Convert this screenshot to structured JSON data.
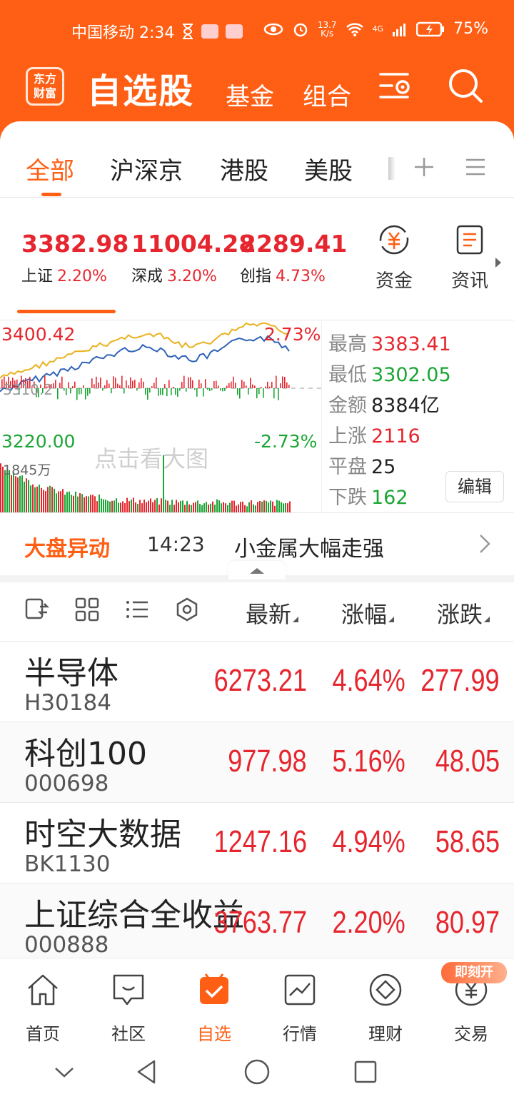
{
  "status_bar": {
    "carrier_time": "中国移动 2:34",
    "net_speed_value": "13.7",
    "net_speed_unit": "K/s",
    "network_type": "4G",
    "battery": "75%"
  },
  "header": {
    "logo_line1": "东方",
    "logo_line2": "财富",
    "title": "自选股",
    "nav": [
      "基金",
      "组合"
    ],
    "icons": [
      "settings-icon",
      "search-icon"
    ]
  },
  "market_tabs": {
    "tabs": [
      "全部",
      "沪深京",
      "港股",
      "美股"
    ],
    "active": "全部",
    "icons": [
      "plus-icon",
      "menu-icon"
    ]
  },
  "indices": [
    {
      "value": "3382.98",
      "name": "上证",
      "pct": "2.20%"
    },
    {
      "value": "11004.28",
      "name": "深成",
      "pct": "3.20%"
    },
    {
      "value": "2289.41",
      "name": "创指",
      "pct": "4.73%"
    }
  ],
  "strip_buttons": [
    {
      "label": "资金",
      "icon": "yuan-flow-icon"
    },
    {
      "label": "资讯",
      "icon": "news-icon"
    }
  ],
  "chart": {
    "high_label": "3400.42",
    "high_pct": "2.73%",
    "low_label": "3220.00",
    "low_pct": "-2.73%",
    "volume_label": "1845万",
    "watermark": "点击看大图",
    "mid_label": "3310.2"
  },
  "stats": [
    {
      "key": "最高",
      "value": "3383.41",
      "color": "#e6262e"
    },
    {
      "key": "最低",
      "value": "3302.05",
      "color": "#1aa534"
    },
    {
      "key": "金额",
      "value": "8384亿",
      "color": "#222222"
    },
    {
      "key": "上涨",
      "value": "2116",
      "color": "#e6262e"
    },
    {
      "key": "平盘",
      "value": "25",
      "color": "#222222"
    },
    {
      "key": "下跌",
      "value": "162",
      "color": "#1aa534"
    }
  ],
  "edit_label": "编辑",
  "movement": {
    "title": "大盘异动",
    "time": "14:23",
    "text": "小金属大幅走强"
  },
  "list_header": {
    "icons": [
      "switch-view-icon",
      "grid-icon",
      "list-icon",
      "gear-circle-icon"
    ],
    "columns": [
      "最新",
      "涨幅",
      "涨跌"
    ]
  },
  "stocks": [
    {
      "name": "半导体",
      "code": "H30184",
      "price": "6273.21",
      "pct": "4.64%",
      "change": "277.99"
    },
    {
      "name": "科创100",
      "code": "000698",
      "price": "977.98",
      "pct": "5.16%",
      "change": "48.05"
    },
    {
      "name": "时空大数据",
      "code": "BK1130",
      "price": "1247.16",
      "pct": "4.94%",
      "change": "58.65"
    },
    {
      "name": "上证综合全收益",
      "code": "000888",
      "price": "3763.77",
      "pct": "2.20%",
      "change": "80.97"
    }
  ],
  "bottom_nav": [
    {
      "label": "首页",
      "icon": "home-icon"
    },
    {
      "label": "社区",
      "icon": "community-icon"
    },
    {
      "label": "自选",
      "icon": "watchlist-icon"
    },
    {
      "label": "行情",
      "icon": "market-icon"
    },
    {
      "label": "理财",
      "icon": "finance-icon"
    },
    {
      "label": "交易",
      "icon": "trade-icon"
    }
  ],
  "bottom_nav_active": "自选",
  "promo_badge": "即刻开",
  "colors": {
    "brand": "#ff5f14",
    "up": "#e6262e",
    "down": "#1aa534"
  }
}
